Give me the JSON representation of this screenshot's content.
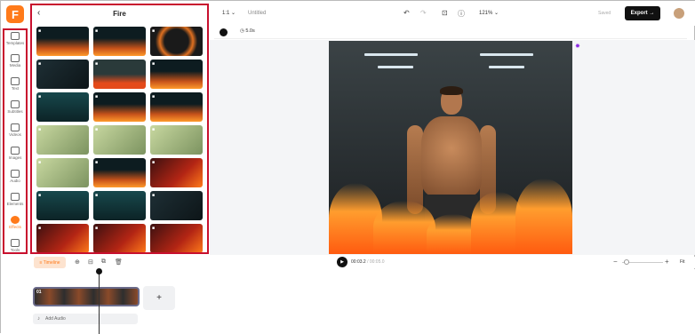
{
  "rail": {
    "logo": "F",
    "items": [
      {
        "label": "Templates",
        "icon": "templates-icon"
      },
      {
        "label": "Media",
        "icon": "media-icon"
      },
      {
        "label": "Text",
        "icon": "text-icon"
      },
      {
        "label": "Subtitles",
        "icon": "subtitles-icon"
      },
      {
        "label": "Videos",
        "icon": "videos-icon"
      },
      {
        "label": "Images",
        "icon": "images-icon"
      },
      {
        "label": "Audio",
        "icon": "audio-icon"
      },
      {
        "label": "Elements",
        "icon": "elements-icon"
      },
      {
        "label": "Effects",
        "icon": "effects-icon",
        "active": true
      },
      {
        "label": "Tools",
        "icon": "tools-icon"
      }
    ]
  },
  "panel": {
    "title": "Fire",
    "back_icon": "chevron-left-icon"
  },
  "topbar": {
    "ratio": "1:1",
    "project_name": "Untitled",
    "zoom": "121%",
    "saved": "Saved",
    "export_label": "Export"
  },
  "controls": {
    "duration": "5.0s"
  },
  "playback": {
    "timeline_label": "Timeline",
    "current_time": "00:03.2",
    "total_time": "00:05.0",
    "fit_label": "Fit"
  },
  "timeline": {
    "clip_number": "01",
    "add_audio_label": "Add Audio"
  },
  "colors": {
    "accent": "#ff7a1a",
    "highlight_border": "#c8102e"
  }
}
